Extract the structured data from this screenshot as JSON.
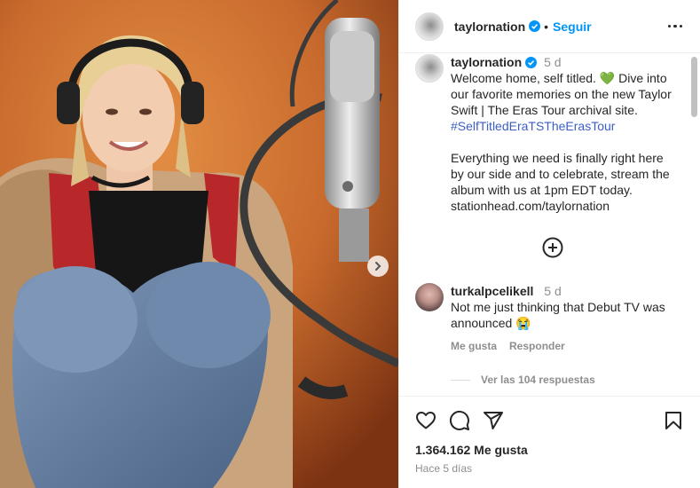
{
  "post": {
    "username": "taylornation",
    "dot": "•",
    "follow_label": "Seguir",
    "caption_time": "5 d",
    "caption_lines": "Welcome home, self titled. 💚 Dive into our favorite memories on the new Taylor Swift | The Eras Tour archival site. ",
    "hashtag": "#SelfTitledEraTSTheErasTour",
    "caption_para2": "Everything we need is finally right here by our side and to celebrate, stream the album with us at 1pm EDT today. stationhead.com/taylornation"
  },
  "comment": {
    "username": "turkalpcelikell",
    "time": "5 d",
    "text": "Not me just thinking that Debut TV was announced 😭",
    "like_label": "Me gusta",
    "reply_label": "Responder",
    "view_replies": "Ver las 104 respuestas"
  },
  "footer": {
    "likes": "1.364.162 Me gusta",
    "date": "Hace 5 días"
  },
  "icons": {
    "verified": "verified-badge-icon",
    "more": "more-options-icon",
    "plus": "load-more-comments-icon",
    "heart": "heart-icon",
    "comment": "comment-icon",
    "share": "share-icon",
    "save": "bookmark-icon",
    "next": "chevron-right-icon"
  },
  "colors": {
    "accent": "#0095f6",
    "hashtag": "#3d5ec4",
    "muted": "#8e8e8e",
    "verified": "#0095f6"
  }
}
